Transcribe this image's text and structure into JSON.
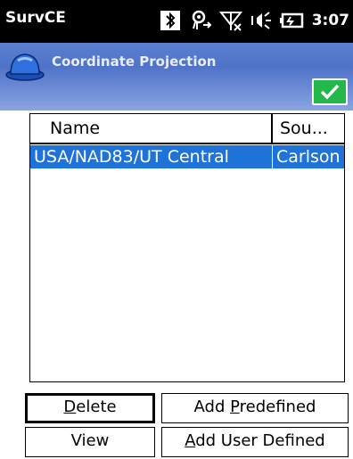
{
  "statusbar": {
    "app_title": "SurvCE",
    "time": "3:07",
    "icons": [
      "bluetooth-icon",
      "connection-sync-icon",
      "signal-off-icon",
      "volume-icon",
      "battery-icon"
    ]
  },
  "header": {
    "title": "Coordinate Projection",
    "ok_icon": "checkmark-icon"
  },
  "list": {
    "columns": {
      "name": "Name",
      "source": "Sou..."
    },
    "rows": [
      {
        "name": "USA/NAD83/UT Central",
        "source": "Carlson",
        "selected": true
      }
    ]
  },
  "buttons": {
    "delete": {
      "mnemonic": "D",
      "rest": "elete"
    },
    "add_predefined": {
      "before": "Add ",
      "mnemonic": "P",
      "rest": "redefined"
    },
    "view": {
      "label": "View"
    },
    "add_user_defined": {
      "mnemonic": "A",
      "rest": "dd User Defined"
    }
  },
  "colors": {
    "statusbar_bg": "#000000",
    "header_gradient_top": "#5b7fd0",
    "header_gradient_bottom": "#8aa3e2",
    "ok_green": "#22b84a",
    "selection_blue": "#1e72d8"
  }
}
